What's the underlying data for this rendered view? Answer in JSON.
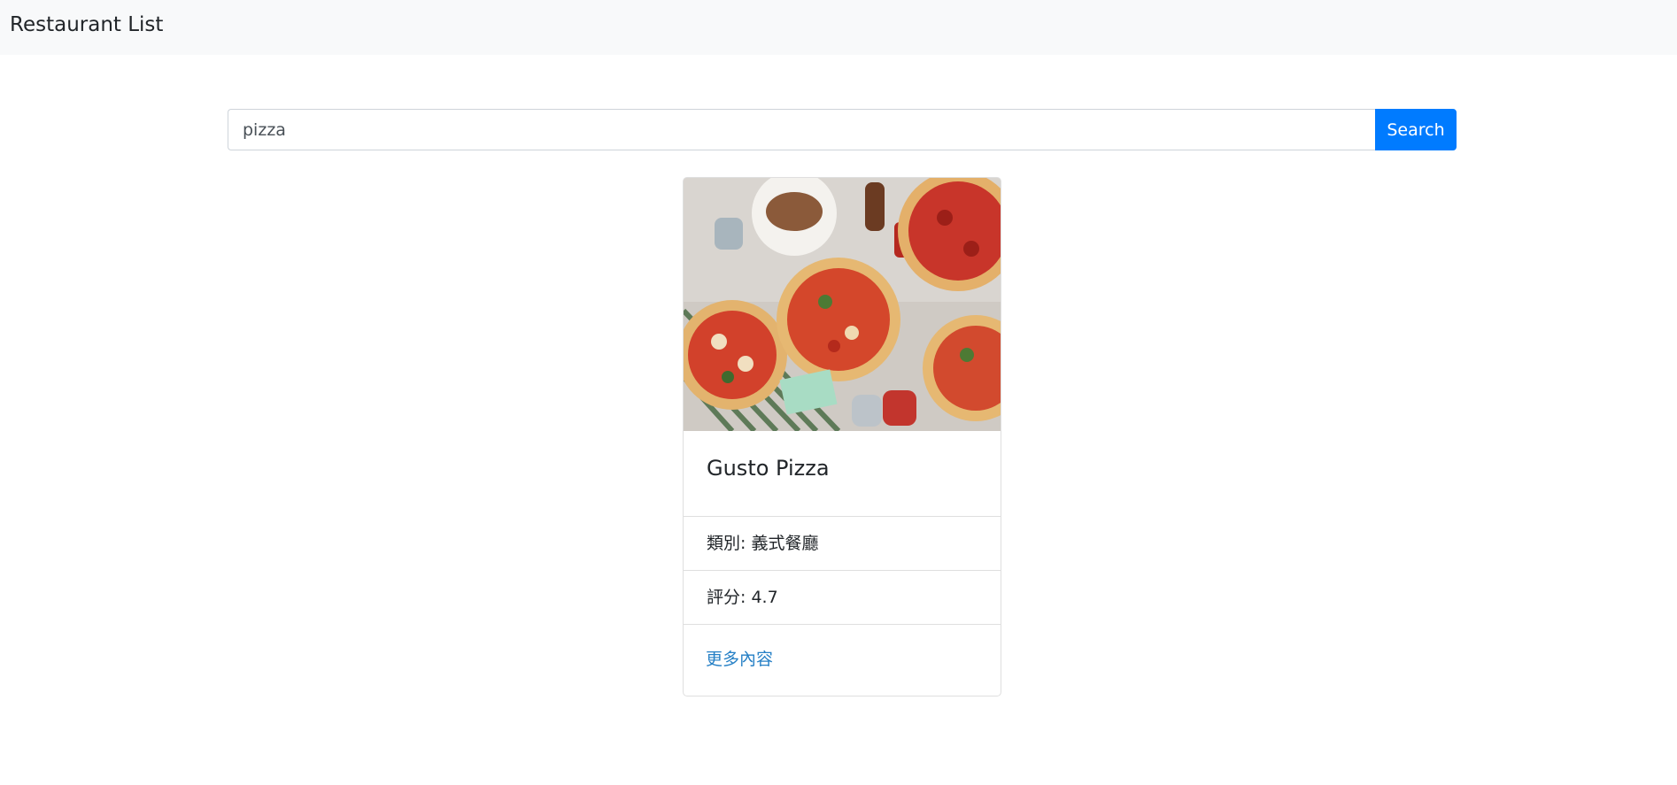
{
  "navbar": {
    "brand": "Restaurant List"
  },
  "search": {
    "value": "pizza",
    "button_label": "Search"
  },
  "restaurant": {
    "name": "Gusto Pizza",
    "category_label": "類別:",
    "category": "義式餐廳",
    "rating_label": "評分:",
    "rating": "4.7",
    "more_link": "更多內容"
  },
  "colors": {
    "primary": "#007bff",
    "link": "#2680c6",
    "navbar_bg": "#f8f9fa"
  }
}
